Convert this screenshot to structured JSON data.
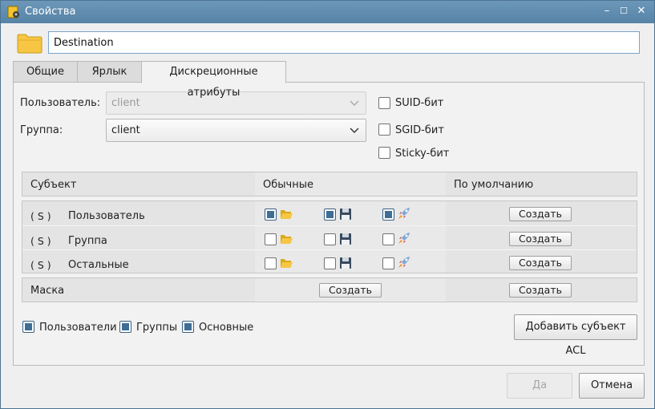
{
  "window": {
    "title": "Свойства",
    "controls": [
      "–",
      "☐",
      "✕"
    ]
  },
  "file": {
    "name": "Destination"
  },
  "tabs": [
    {
      "label": "Общие"
    },
    {
      "label": "Ярлык"
    },
    {
      "label": "Дискреционные атрибуты"
    }
  ],
  "owner": {
    "user_label": "Пользователь:",
    "user_value": "client",
    "group_label": "Группа:",
    "group_value": "client"
  },
  "special_bits": [
    {
      "label": "SUID-бит",
      "checked": false
    },
    {
      "label": "SGID-бит",
      "checked": false
    },
    {
      "label": "Sticky-бит",
      "checked": false
    }
  ],
  "acl": {
    "headers": {
      "subject": "Субъект",
      "regular": "Обычные",
      "default": "По умолчанию"
    },
    "rows": [
      {
        "tag": "( S )",
        "subject": "Пользователь",
        "read": true,
        "write": true,
        "exec": true
      },
      {
        "tag": "( S )",
        "subject": "Группа",
        "read": false,
        "write": false,
        "exec": false
      },
      {
        "tag": "( S )",
        "subject": "Остальные",
        "read": false,
        "write": false,
        "exec": false
      }
    ],
    "create_label": "Создать",
    "mask_label": "Маска"
  },
  "filters": [
    {
      "label": "Пользователи",
      "checked": true
    },
    {
      "label": "Группы",
      "checked": true
    },
    {
      "label": "Основные",
      "checked": true
    }
  ],
  "add_acl_label": "Добавить субъект ACL",
  "buttons": {
    "ok": "Да",
    "cancel": "Отмена"
  },
  "colors": {
    "accent": "#3e6d96",
    "titlebar": "#5f8bae",
    "folder": "#f6c644"
  }
}
